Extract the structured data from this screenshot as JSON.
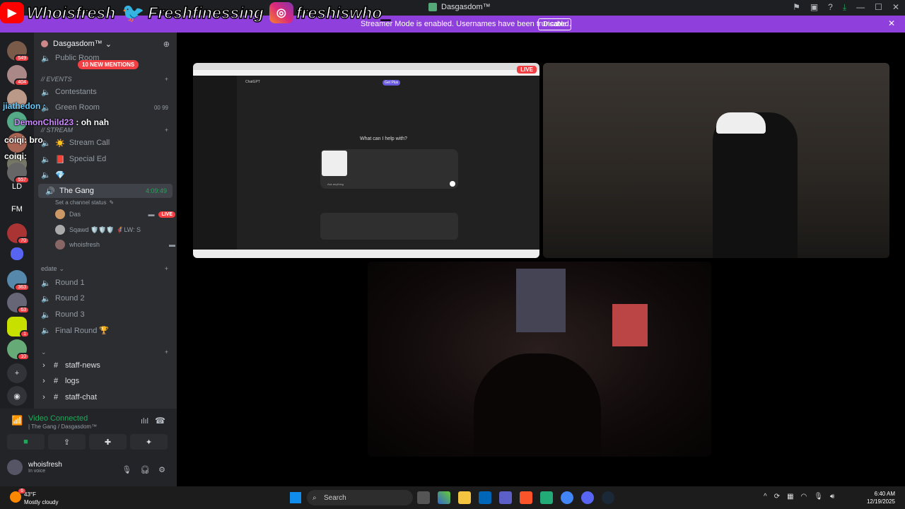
{
  "window": {
    "title": "Dasgasdom™",
    "min": "—",
    "max": "☐",
    "close": "✕"
  },
  "banner": {
    "text": "Streamer Mode is enabled. Usernames have been truncated.",
    "disable": "Disable",
    "close": "✕"
  },
  "socials": [
    {
      "icon": "youtube-icon",
      "text": "Whoisfresh",
      "color": "#ff0000"
    },
    {
      "icon": "twitter-icon",
      "text": "Freshfinessing",
      "color": "#1da1f2"
    },
    {
      "icon": "instagram-icon",
      "text": "freshiswho_",
      "color": "#c13584"
    }
  ],
  "guilds": [
    {
      "badge": "549"
    },
    {
      "badge": "404"
    },
    {
      "badge": ""
    },
    {
      "badge": ""
    },
    {
      "badge": ""
    },
    {
      "badge": ""
    },
    {
      "badge": "557"
    },
    {
      "label": "LD"
    },
    {
      "label": "FM"
    },
    {
      "badge": "70"
    },
    {
      "badge": ""
    },
    {
      "badge": "363"
    },
    {
      "badge": "63"
    },
    {
      "badge": "1"
    },
    {
      "badge": "10"
    }
  ],
  "server": {
    "name": "Dasgasdom™",
    "mentions": "10 NEW MENTIONS"
  },
  "channels": {
    "public_room": "Public Room",
    "events_cat": "// Events",
    "contestants": "Contestants",
    "green_room": "Green Room",
    "stream_cat": "// STREAM",
    "stream_call": "Stream Call",
    "special_ed": "Special Ed",
    "the_gang": "The Gang",
    "the_gang_time": "4:09:49",
    "channel_status": "Set a channel status",
    "green_room_counts": "00 99",
    "edate_cat": "edate",
    "round1": "Round 1",
    "round2": "Round 2",
    "round3": "Round 3",
    "final_round": "Final Round 🏆",
    "staff_news": "staff-news",
    "logs": "logs",
    "staff_chat": "staff-chat"
  },
  "voice_users": [
    {
      "name": "Das",
      "live": "LIVE"
    },
    {
      "name": "Sqawd 🛡️🛡️🛡️ 🦸LW: S"
    },
    {
      "name": "whoisfresh"
    }
  ],
  "chat_overlay": [
    {
      "user": "jiathedon",
      "text": ":"
    },
    {
      "user": "DemonChild23",
      "text": ": oh nah"
    },
    {
      "user": "coiqi",
      "text": ": bro"
    },
    {
      "user": "coiqi",
      "text": ":"
    }
  ],
  "voice_panel": {
    "status": "Video Connected",
    "location": "| The Gang / Dasgasdom™"
  },
  "me": {
    "name": "whoisfresh",
    "status": "In voice"
  },
  "stream": {
    "live": "LIVE",
    "chat_app": "ChatGPT",
    "prompt": "What can I help with?",
    "get_plus": "Get Plus",
    "ask_anything": "Ask anything"
  },
  "taskbar": {
    "temp": "43°F",
    "weather": "Mostly cloudy",
    "search": "Search",
    "time": "6:40 AM",
    "date": "12/19/2025",
    "weather_badge": "6"
  }
}
